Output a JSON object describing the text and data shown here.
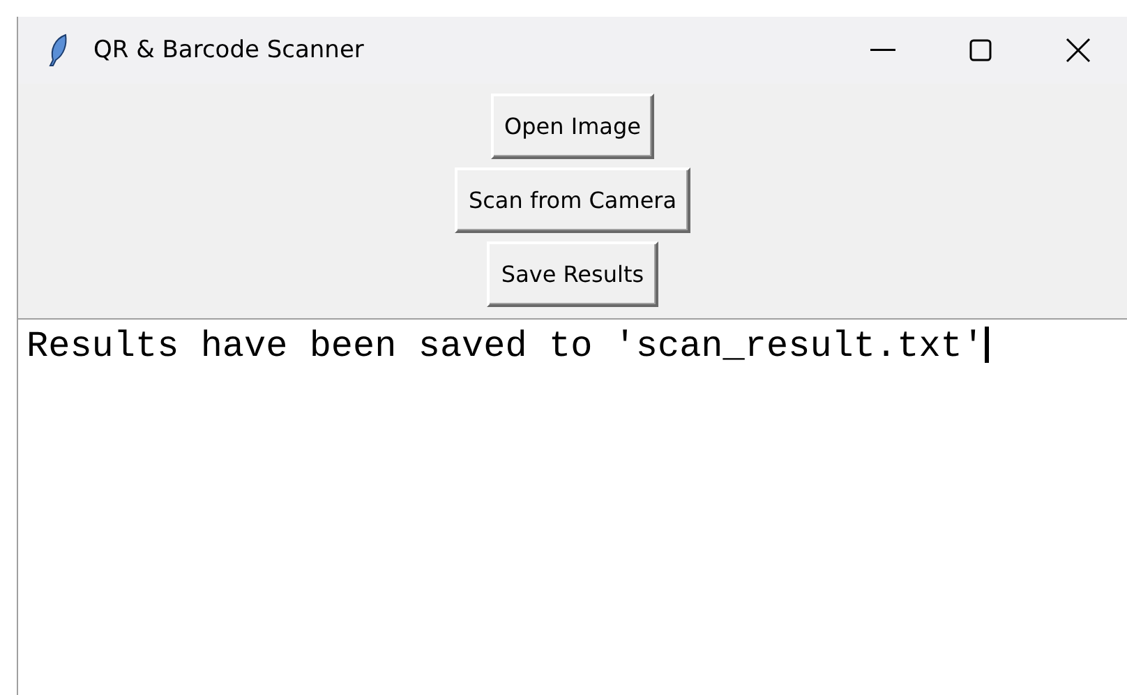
{
  "window": {
    "title": "QR & Barcode Scanner"
  },
  "buttons": [
    {
      "label": "Open Image"
    },
    {
      "label": "Scan from Camera"
    },
    {
      "label": "Save Results"
    }
  ],
  "output": {
    "value": "Results have been saved to 'scan_result.txt'",
    "focused": true
  }
}
